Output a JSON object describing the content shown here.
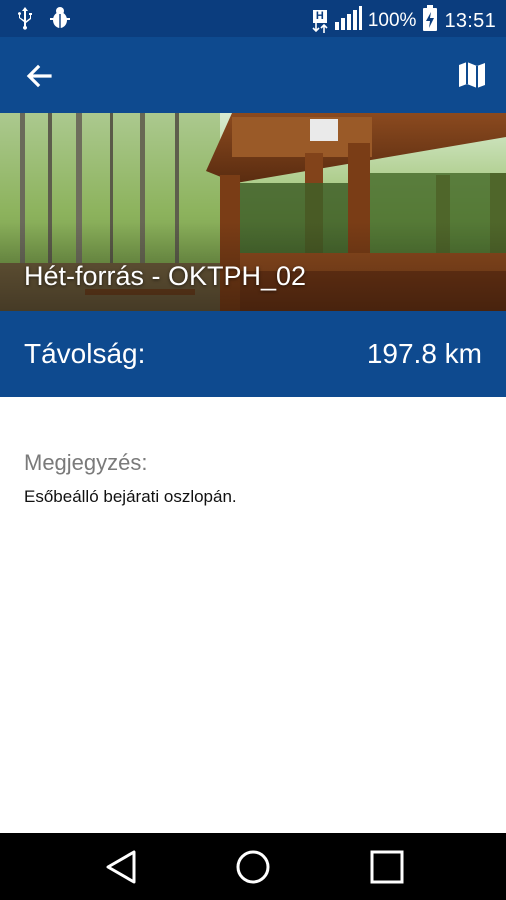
{
  "status_bar": {
    "network_label": "H",
    "battery_percent": "100%",
    "time": "13:51",
    "icons": [
      "usb-icon",
      "bug-icon",
      "network-h-icon",
      "signal-icon",
      "battery-charging-icon"
    ]
  },
  "app_bar": {
    "icons": [
      "back-arrow-icon",
      "map-icon"
    ],
    "color": "#0e4a8f"
  },
  "hero": {
    "title": "Hét-forrás - OKTPH_02"
  },
  "distance": {
    "label": "Távolság:",
    "value": "197.8 km"
  },
  "note": {
    "label": "Megjegyzés:",
    "text": "Esőbeálló bejárati oszlopán."
  },
  "nav_bar": {
    "icons": [
      "back-triangle-icon",
      "home-circle-icon",
      "recents-square-icon"
    ]
  }
}
